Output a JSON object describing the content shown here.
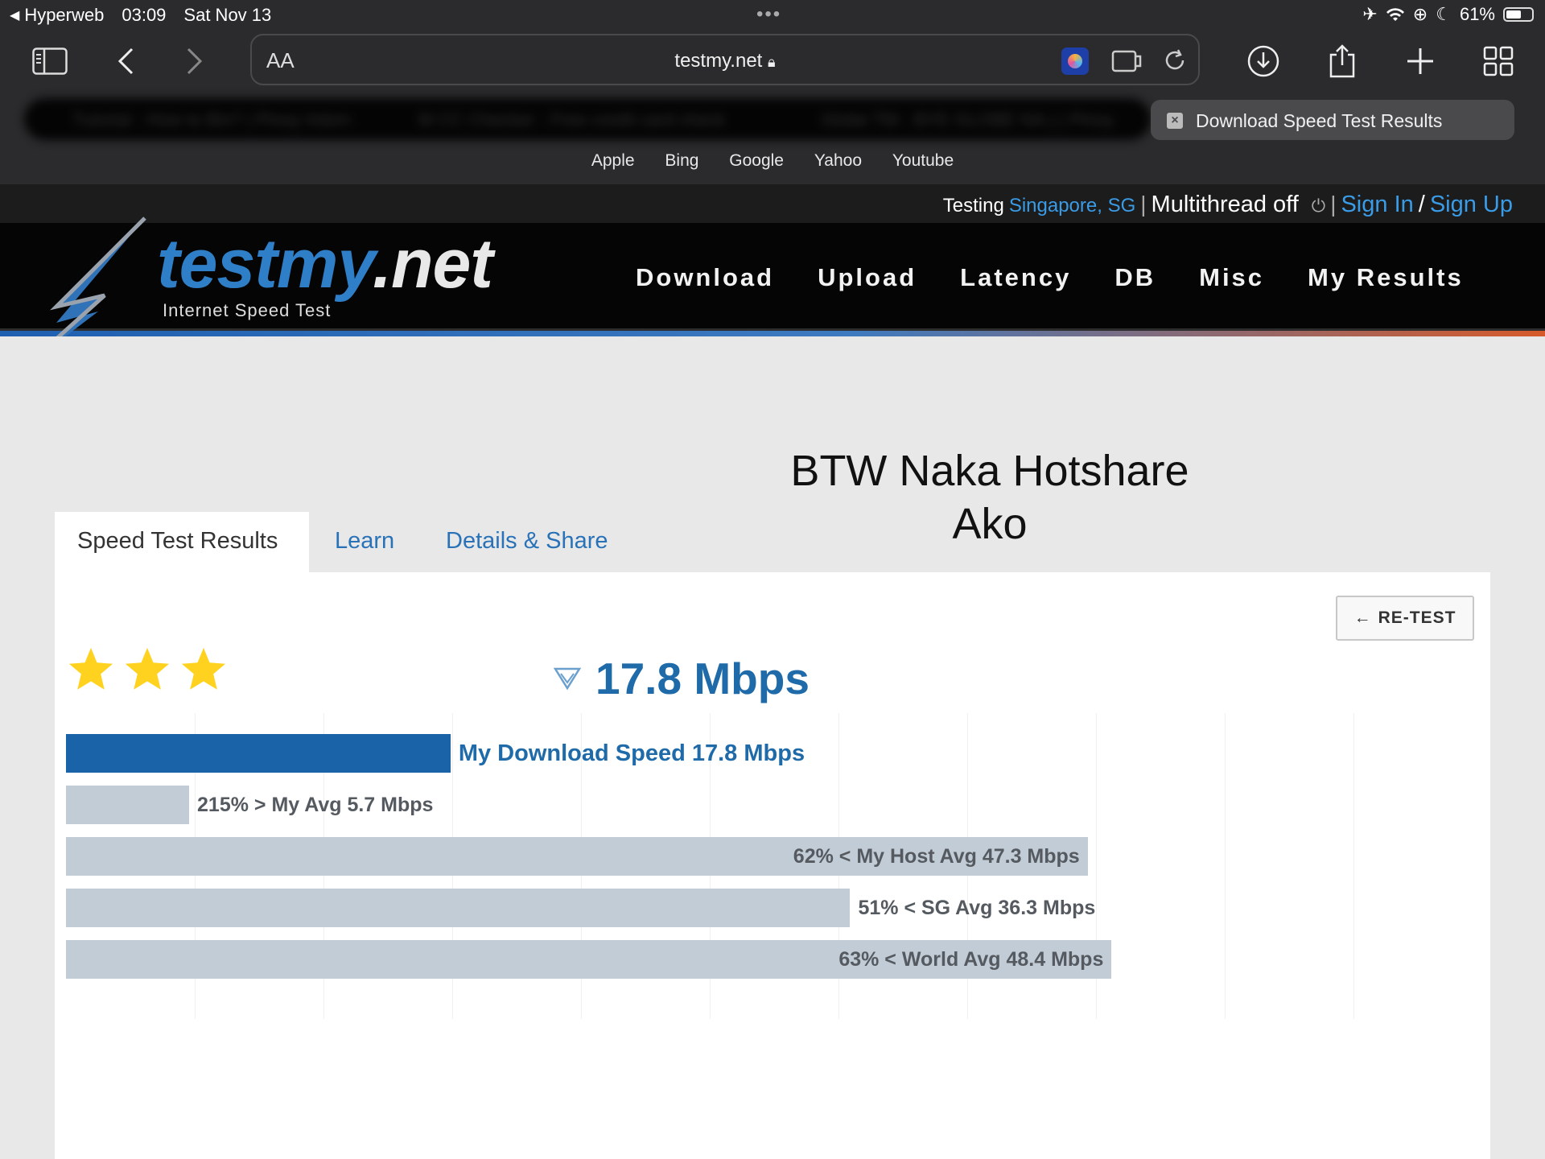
{
  "status_bar": {
    "back_app": "Hyperweb",
    "time": "03:09",
    "date": "Sat Nov 13",
    "battery": "61%",
    "battery_level": 0.61
  },
  "browser": {
    "url": "testmy.net",
    "text_size_label": "AA",
    "blurred_tabs": [
      "Tutorial - How to Bin? | Pinoy Intern",
      "M  CC Checker - Free credit card check",
      "Globe TM - BYE GLOBE NA.) | Pinoy"
    ],
    "active_tab": "Download Speed Test Results",
    "favorites": [
      "Apple",
      "Bing",
      "Google",
      "Yahoo",
      "Youtube"
    ]
  },
  "site_topbar": {
    "testing_label": "Testing",
    "location": "Singapore, SG",
    "sep": "|",
    "multithread": "Multithread off",
    "sign_in": "Sign In",
    "slash": "/",
    "sign_up": "Sign Up"
  },
  "logo": {
    "word_a": "testmy",
    "word_b": ".net",
    "tagline": "Internet Speed Test"
  },
  "nav": [
    "Download",
    "Upload",
    "Latency",
    "DB",
    "Misc",
    "My Results"
  ],
  "heading": {
    "line1": "BTW Naka Hotshare",
    "line2": "Ako"
  },
  "tabs": {
    "results": "Speed Test Results",
    "learn": "Learn",
    "details": "Details & Share"
  },
  "retest_label": "RE-TEST",
  "rating_stars": 3,
  "result_speed": "17.8 Mbps",
  "colors": {
    "primary_bar": "#1b63a8",
    "secondary_bar": "#c2ccd6",
    "primary_text": "#1f6aa8",
    "secondary_text": "#555a60",
    "star": "#ffd21f"
  },
  "chart_data": {
    "type": "bar",
    "orientation": "horizontal",
    "unit": "Mbps",
    "xlim": [
      0,
      59.6
    ],
    "grid": true,
    "series": [
      {
        "label": "My Download Speed 17.8 Mbps",
        "value": 17.8,
        "highlight": true,
        "label_position": "outside"
      },
      {
        "label": "215% > My Avg 5.7 Mbps",
        "value": 5.7,
        "highlight": false,
        "label_position": "outside"
      },
      {
        "label": "62% < My Host Avg 47.3 Mbps",
        "value": 47.3,
        "highlight": false,
        "label_position": "inside"
      },
      {
        "label": "51% < SG Avg 36.3 Mbps",
        "value": 36.3,
        "highlight": false,
        "label_position": "outside"
      },
      {
        "label": "63% < World Avg 48.4 Mbps",
        "value": 48.4,
        "highlight": false,
        "label_position": "inside"
      }
    ]
  }
}
